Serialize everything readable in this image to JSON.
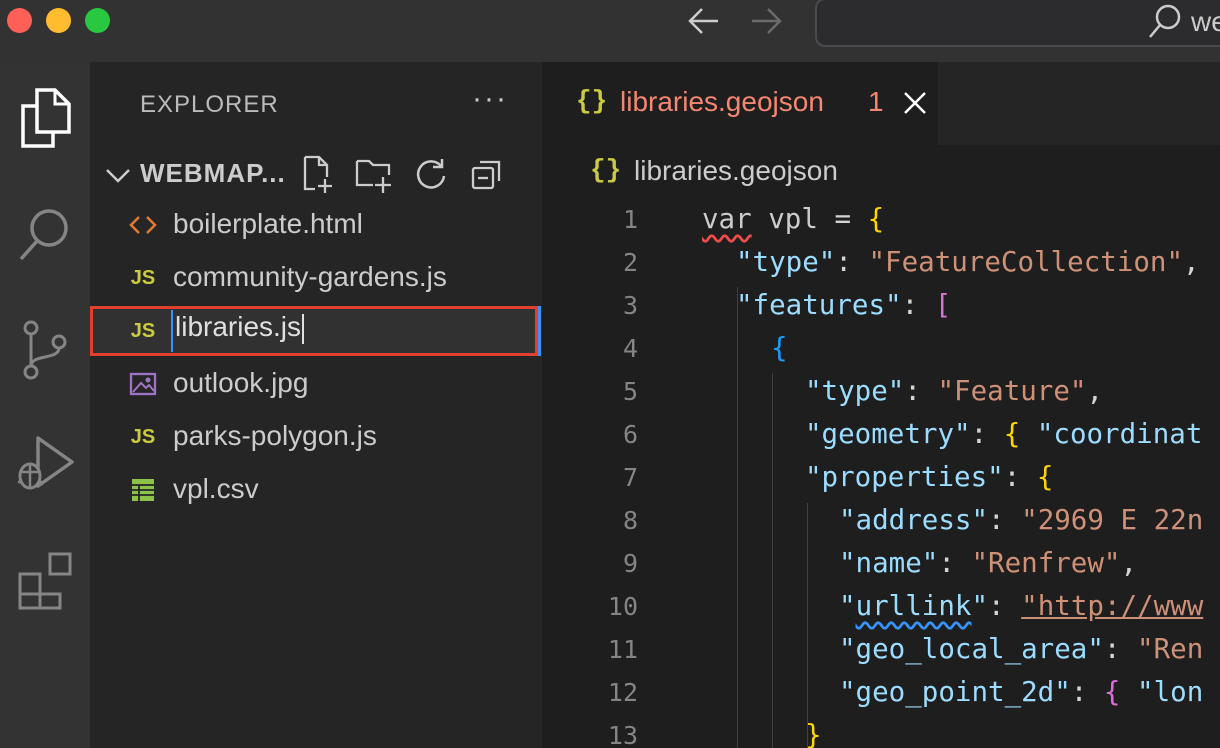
{
  "titlebar": {
    "search_text": "we"
  },
  "sidebar": {
    "title": "EXPLORER",
    "more": "···",
    "folder": "WEBMAP...",
    "files": [
      {
        "icon": "<>",
        "label": "boilerplate.html"
      },
      {
        "icon": "JS",
        "label": "community-gardens.js"
      },
      {
        "icon": "JS",
        "label": "libraries.js",
        "renaming": true
      },
      {
        "icon": "image",
        "label": "outlook.jpg"
      },
      {
        "icon": "JS",
        "label": "parks-polygon.js"
      },
      {
        "icon": "table",
        "label": "vpl.csv"
      }
    ]
  },
  "editor": {
    "tab": {
      "icon": "{}",
      "label": "libraries.geojson",
      "badge": "1"
    },
    "breadcrumb": {
      "icon": "{}",
      "label": "libraries.geojson"
    },
    "line_numbers": [
      "1",
      "2",
      "3",
      "4",
      "5",
      "6",
      "7",
      "8",
      "9",
      "10",
      "11",
      "12",
      "13"
    ],
    "code": {
      "l1_kw": "var",
      "l1_name": "vpl",
      "l1_eq": " = ",
      "l1_brace": "{",
      "l2_key": "\"type\"",
      "l2_val": "\"FeatureCollection\"",
      "l3_key": "\"features\"",
      "l3_br": "[",
      "l4_br": "{",
      "l5_key": "\"type\"",
      "l5_val": "\"Feature\"",
      "l6_key": "\"geometry\"",
      "l6_br": "{",
      "l6_rest": "\"coordinat",
      "l7_key": "\"properties\"",
      "l7_br": "{",
      "l8_key": "\"address\"",
      "l8_val": "\"2969 E 22n",
      "l9_key": "\"name\"",
      "l9_val": "\"Renfrew\"",
      "l10_q1": "\"",
      "l10_key": "urllink",
      "l10_q2": "\"",
      "l10_val": "\"http://www",
      "l11_key": "\"geo_local_area\"",
      "l11_val": "\"Ren",
      "l12_key": "\"geo_point_2d\"",
      "l12_br": "{",
      "l12_rest": "\"lon",
      "l13_br": "}",
      "colon": ": ",
      "comma": ","
    }
  },
  "colors": {
    "accent": "#3794ff",
    "rename_border": "#e2402f",
    "error_tab": "#f48771",
    "js_icon": "#cbcb41"
  }
}
